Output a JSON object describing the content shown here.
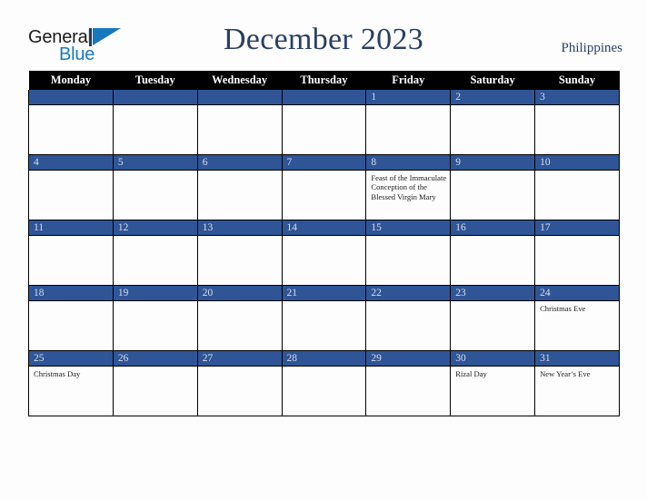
{
  "branding": {
    "logo_text_primary": "General",
    "logo_text_secondary": "Blue",
    "logo_mark": "triangle-flag-icon",
    "accent_color": "#1878be"
  },
  "header": {
    "title": "December 2023",
    "country": "Philippines",
    "title_color": "#2b3f63"
  },
  "calendar": {
    "month": "December",
    "year": "2023",
    "header_bg": "#000000",
    "daynum_bg": "#2f5597",
    "weekdays": [
      "Monday",
      "Tuesday",
      "Wednesday",
      "Thursday",
      "Friday",
      "Saturday",
      "Sunday"
    ],
    "weeks": [
      [
        {
          "day": "",
          "event": ""
        },
        {
          "day": "",
          "event": ""
        },
        {
          "day": "",
          "event": ""
        },
        {
          "day": "",
          "event": ""
        },
        {
          "day": "1",
          "event": ""
        },
        {
          "day": "2",
          "event": ""
        },
        {
          "day": "3",
          "event": ""
        }
      ],
      [
        {
          "day": "4",
          "event": ""
        },
        {
          "day": "5",
          "event": ""
        },
        {
          "day": "6",
          "event": ""
        },
        {
          "day": "7",
          "event": ""
        },
        {
          "day": "8",
          "event": "Feast of the Immaculate Conception of the Blessed Virgin Mary"
        },
        {
          "day": "9",
          "event": ""
        },
        {
          "day": "10",
          "event": ""
        }
      ],
      [
        {
          "day": "11",
          "event": ""
        },
        {
          "day": "12",
          "event": ""
        },
        {
          "day": "13",
          "event": ""
        },
        {
          "day": "14",
          "event": ""
        },
        {
          "day": "15",
          "event": ""
        },
        {
          "day": "16",
          "event": ""
        },
        {
          "day": "17",
          "event": ""
        }
      ],
      [
        {
          "day": "18",
          "event": ""
        },
        {
          "day": "19",
          "event": ""
        },
        {
          "day": "20",
          "event": ""
        },
        {
          "day": "21",
          "event": ""
        },
        {
          "day": "22",
          "event": ""
        },
        {
          "day": "23",
          "event": ""
        },
        {
          "day": "24",
          "event": "Christmas Eve"
        }
      ],
      [
        {
          "day": "25",
          "event": "Christmas Day"
        },
        {
          "day": "26",
          "event": ""
        },
        {
          "day": "27",
          "event": ""
        },
        {
          "day": "28",
          "event": ""
        },
        {
          "day": "29",
          "event": ""
        },
        {
          "day": "30",
          "event": "Rizal Day"
        },
        {
          "day": "31",
          "event": "New Year’s Eve"
        }
      ]
    ]
  }
}
